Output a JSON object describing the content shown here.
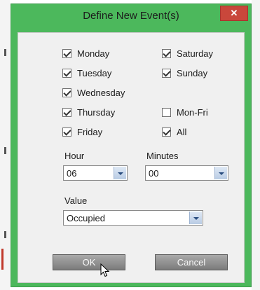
{
  "dialog": {
    "title": "Define New Event(s)",
    "close_glyph": "✕"
  },
  "days": {
    "monday": {
      "label": "Monday",
      "checked": true
    },
    "tuesday": {
      "label": "Tuesday",
      "checked": true
    },
    "wednesday": {
      "label": "Wednesday",
      "checked": true
    },
    "thursday": {
      "label": "Thursday",
      "checked": true
    },
    "friday": {
      "label": "Friday",
      "checked": true
    },
    "saturday": {
      "label": "Saturday",
      "checked": true
    },
    "sunday": {
      "label": "Sunday",
      "checked": true
    },
    "mon_fri": {
      "label": "Mon-Fri",
      "checked": false
    },
    "all": {
      "label": "All",
      "checked": true
    }
  },
  "hour": {
    "label": "Hour",
    "value": "06"
  },
  "minutes": {
    "label": "Minutes",
    "value": "00"
  },
  "value_field": {
    "label": "Value",
    "value": "Occupied"
  },
  "buttons": {
    "ok": "OK",
    "cancel": "Cancel"
  },
  "colors": {
    "title_bar": "#4cb85c",
    "close_button": "#c9473b",
    "content_bg": "#f0f0f0"
  },
  "icons": [
    "close-icon",
    "check-icon",
    "dropdown-arrow-icon",
    "mouse-cursor-icon"
  ]
}
